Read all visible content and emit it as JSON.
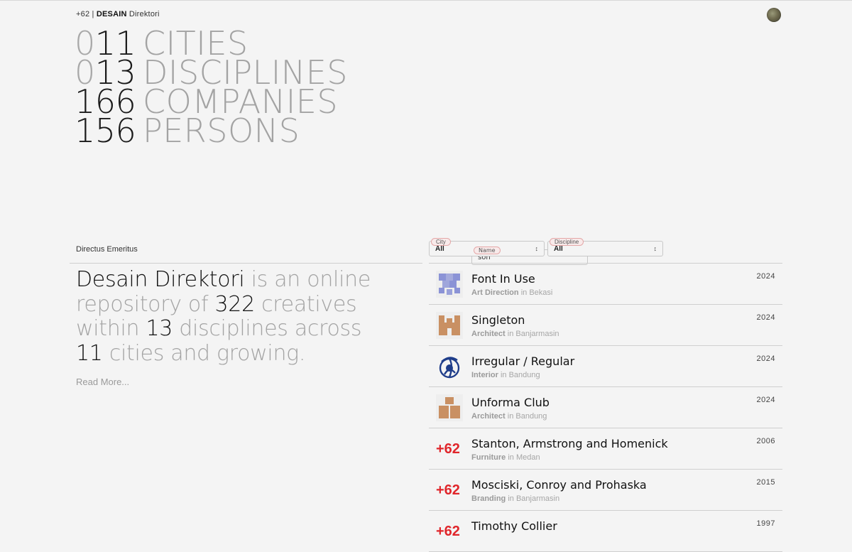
{
  "header": {
    "country_code": "+62",
    "separator": "|",
    "brand": "DESAIN",
    "brand_suffix": "Direktori"
  },
  "stats": [
    {
      "dim": "0",
      "num": "11",
      "label": "CITIES"
    },
    {
      "dim": "0",
      "num": "13",
      "label": "DISCIPLINES"
    },
    {
      "dim": "",
      "num": "166",
      "label": "COMPANIES"
    },
    {
      "dim": "",
      "num": "156",
      "label": "PERSONS"
    }
  ],
  "section": {
    "title": "Directus Emeritus"
  },
  "intro": {
    "brand": "Desain Direktori",
    "t1": " is an online repository of ",
    "creatives_count": "322",
    "t2": " creatives within ",
    "disciplines_count": "13",
    "t3": " disciplines across ",
    "cities_count": "11",
    "t4": " cities and growing.",
    "read_more": "Read More..."
  },
  "filters": {
    "name": {
      "label": "Name",
      "value": "son"
    },
    "city": {
      "label": "City",
      "value": "All"
    },
    "discipline": {
      "label": "Discipline",
      "value": "All"
    }
  },
  "results": [
    {
      "name": "Font In Use",
      "discipline": "Art Direction",
      "in": "in",
      "city": "Bekasi",
      "year": "2024",
      "logo": "purple-checker-logo",
      "color": "#8b93d6"
    },
    {
      "name": "Singleton",
      "discipline": "Architect",
      "in": "in",
      "city": "Banjarmasin",
      "year": "2024",
      "logo": "tan-crown-logo",
      "color": "#c99063"
    },
    {
      "name": "Irregular / Regular",
      "discipline": "Interior",
      "in": "in",
      "city": "Bandung",
      "year": "2024",
      "logo": "blue-swirl-logo",
      "color": "#1f3d8a"
    },
    {
      "name": "Unforma Club",
      "discipline": "Architect",
      "in": "in",
      "city": "Bandung",
      "year": "2024",
      "logo": "tan-blocks-logo",
      "color": "#c99063"
    },
    {
      "name": "Stanton, Armstrong and Homenick",
      "discipline": "Furniture",
      "in": "in",
      "city": "Medan",
      "year": "2006",
      "mark": "+62"
    },
    {
      "name": "Mosciski, Conroy and Prohaska",
      "discipline": "Branding",
      "in": "in",
      "city": "Banjarmasin",
      "year": "2015",
      "mark": "+62"
    },
    {
      "name": "Timothy Collier",
      "discipline": "",
      "in": "",
      "city": "",
      "year": "1997",
      "mark": "+62"
    }
  ]
}
